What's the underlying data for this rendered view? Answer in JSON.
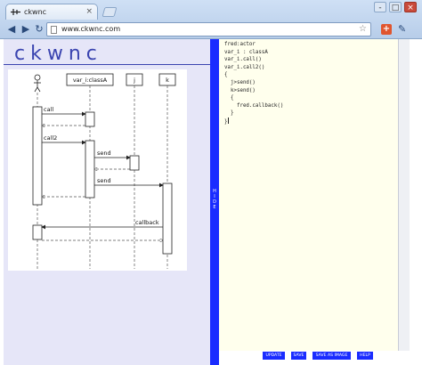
{
  "browser": {
    "tab_title": "ckwnc",
    "tab_close": "×",
    "url": "www.ckwnc.com",
    "window_buttons": [
      "-",
      "□",
      "×"
    ],
    "nav_icons": [
      "back-arrow-icon",
      "forward-arrow-icon",
      "reload-icon"
    ],
    "colors": {
      "chrome": "#b7cde9",
      "extension": "#e0552e"
    }
  },
  "app": {
    "brand": "ckwnc",
    "hide_label": "HIDE",
    "code": "fred:actor\nvar_i : classA\nvar_i.call()\nvar_i.call2()\n{\n  j>send()\n  k>send()\n  {\n    fred.callback()\n  }\n}",
    "buttons": {
      "update": "UPDATE",
      "save": "SAVE",
      "save_as_image": "SAVE AS IMAGE",
      "help": "HELP"
    },
    "colors": {
      "accent": "#1a2cff",
      "brand": "#3a44b0",
      "left_bg": "#e6e6f8",
      "editor_bg": "#ffffed"
    }
  },
  "diagram": {
    "participants": [
      {
        "name": "",
        "kind": "actor"
      },
      {
        "name": "var_i:classA",
        "kind": "object"
      },
      {
        "name": "j",
        "kind": "object"
      },
      {
        "name": "k",
        "kind": "object"
      }
    ],
    "messages": [
      {
        "label": "call"
      },
      {
        "label": "call2"
      },
      {
        "label": "send"
      },
      {
        "label": "send"
      },
      {
        "label": "callback"
      }
    ]
  }
}
